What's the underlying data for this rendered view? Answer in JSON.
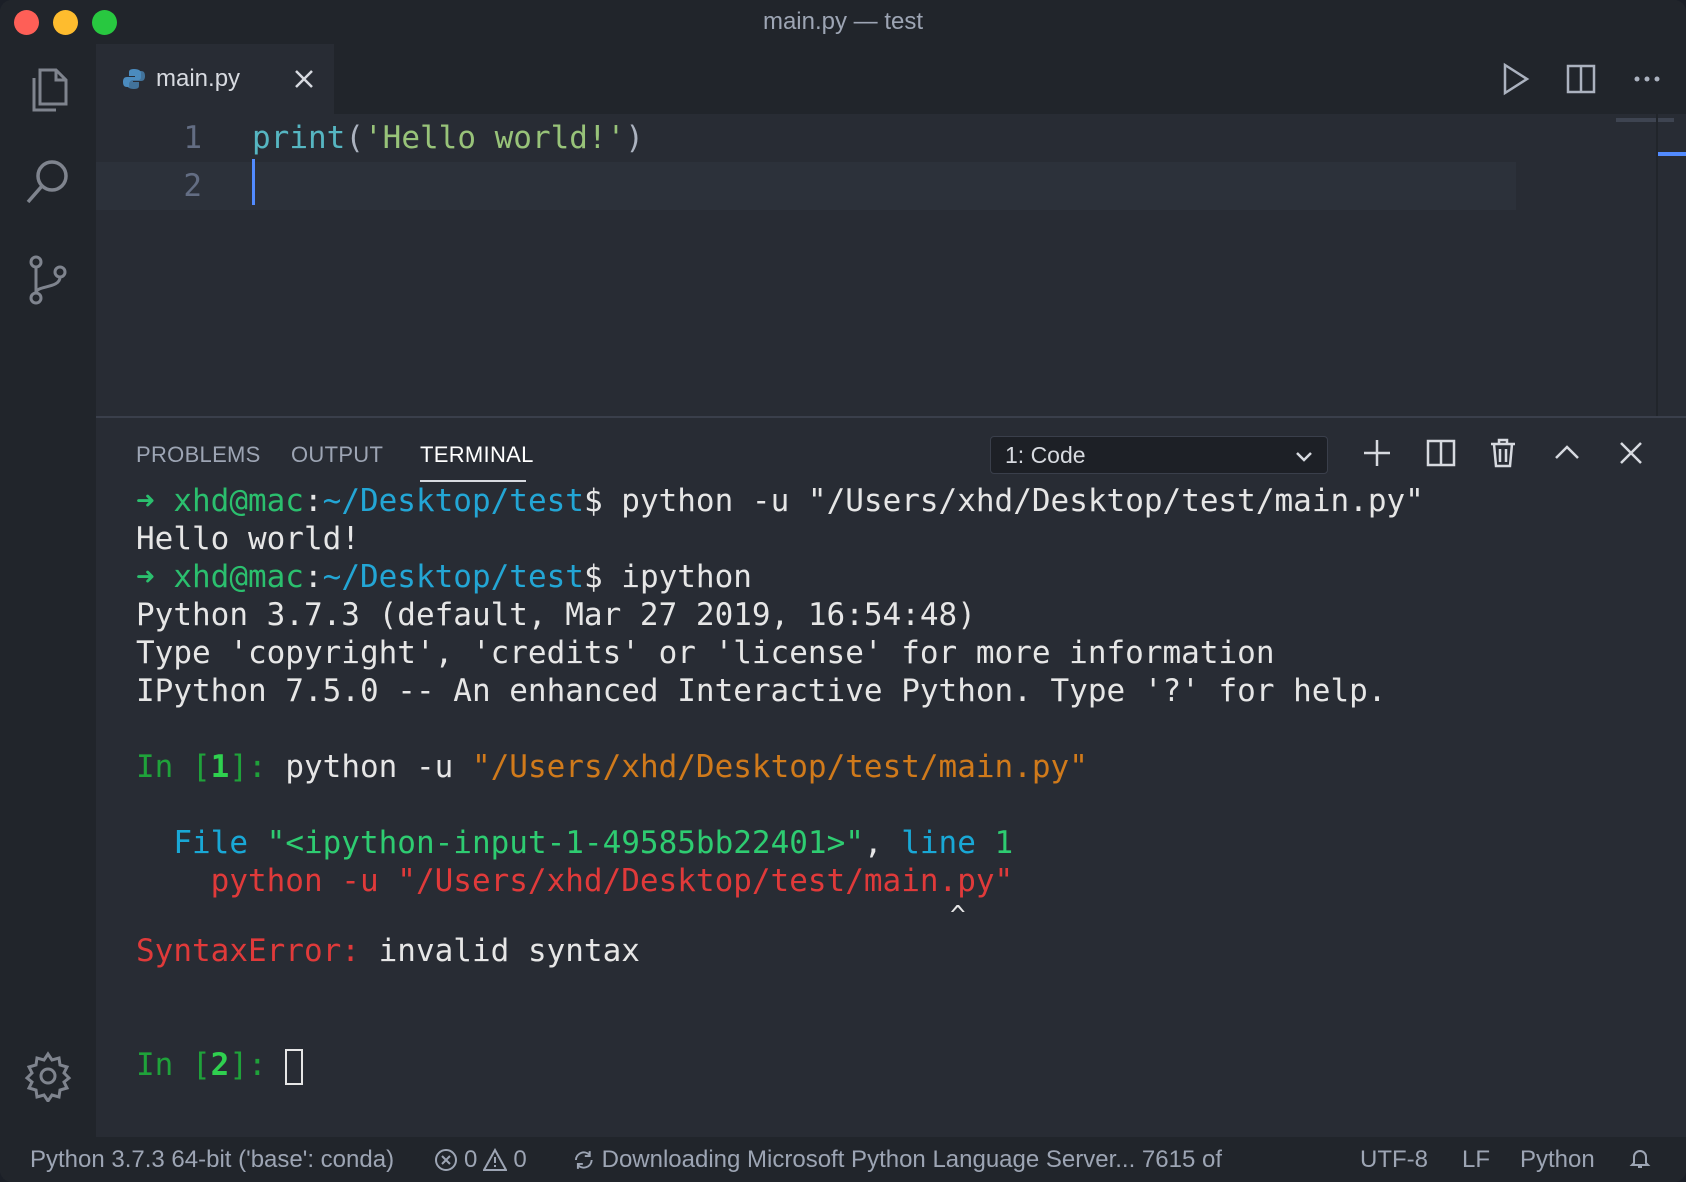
{
  "window": {
    "title": "main.py — test"
  },
  "activity_bar": {
    "items": [
      "files-icon",
      "search-icon",
      "source-control-icon"
    ],
    "bottom": "gear-icon"
  },
  "tabs": [
    {
      "label": "main.py",
      "icon": "python-file-icon",
      "active": true
    }
  ],
  "editor": {
    "lines": [
      {
        "number": "1",
        "fn": "print",
        "open": "(",
        "str": "'Hello world!'",
        "close": ")"
      },
      {
        "number": "2"
      }
    ]
  },
  "panel": {
    "tabs": [
      "PROBLEMS",
      "OUTPUT",
      "TERMINAL"
    ],
    "active_tab": "TERMINAL",
    "terminal_selector": "1: Code"
  },
  "terminal": {
    "line1": {
      "arrow": "➜ ",
      "userhost": "xhd@mac",
      "colon": ":",
      "path": "~/Desktop/test",
      "dollar": "$ ",
      "cmd": "python -u \"/Users/xhd/Desktop/test/main.py\""
    },
    "line2": "Hello world!",
    "line3": {
      "arrow": "➜ ",
      "userhost": "xhd@mac",
      "colon": ":",
      "path": "~/Desktop/test",
      "dollar": "$ ",
      "cmd": "ipython"
    },
    "line4": "Python 3.7.3 (default, Mar 27 2019, 16:54:48)",
    "line5": "Type 'copyright', 'credits' or 'license' for more information",
    "line6": "IPython 7.5.0 -- An enhanced Interactive Python. Type '?' for help.",
    "in1": {
      "prefix": "In [",
      "num": "1",
      "suffix": "]: ",
      "cmd": "python -u ",
      "arg": "\"/Users/xhd/Desktop/test/main.py\""
    },
    "file_line": {
      "indent": "  ",
      "file": "File ",
      "name": "\"<ipython-input-1-49585bb22401>\"",
      "comma": ", ",
      "line_word": "line ",
      "line_num": "1"
    },
    "error_src": "    python -u \"/Users/xhd/Desktop/test/main.py\"",
    "caret_line": "                                                    ^",
    "error": {
      "type": "SyntaxError:",
      "msg": " invalid syntax"
    },
    "in2": {
      "prefix": "In [",
      "num": "2",
      "suffix": "]: "
    }
  },
  "statusbar": {
    "interpreter": "Python 3.7.3 64-bit ('base': conda)",
    "errors": "0",
    "warnings": "0",
    "progress": "Downloading Microsoft Python Language Server... 7615 of",
    "encoding": "UTF-8",
    "eol": "LF",
    "language": "Python"
  }
}
